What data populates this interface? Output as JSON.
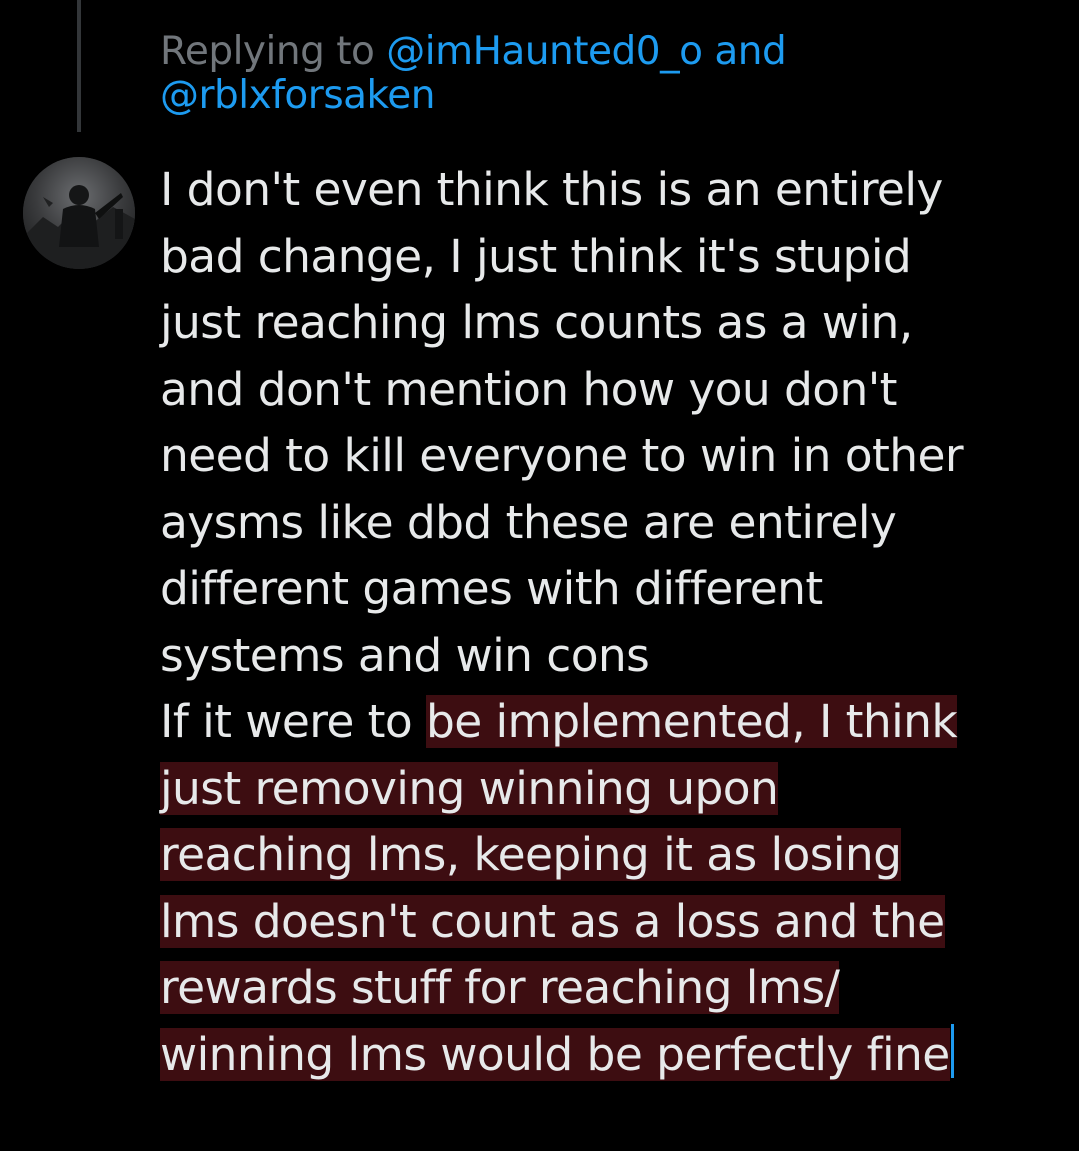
{
  "reply_header": {
    "prefix": "Replying to",
    "mention_1": "@imHaunted0_o",
    "joiner": "and",
    "mention_2": "@rblxforsaken"
  },
  "tweet": {
    "avatar_icon": "user-avatar-icon",
    "text_plain": "I don't even think this is an entirely\nbad change, I just think it's stupid\njust reaching lms counts as a win,\nand don't mention how you don't\nneed to kill everyone to win in other\naysms like dbd these are entirely\ndifferent games with different\nsystems and win cons\nIf it were to ",
    "text_selected": "be implemented, I think\njust removing winning upon\nreaching lms, keeping it as losing\nlms doesn't count as a loss and the\nrewards stuff for reaching lms/\nwinning lms would be perfectly fine"
  },
  "colors": {
    "background": "#000000",
    "text": "#e7e9ea",
    "secondary_text": "#71767b",
    "accent": "#1d9bf0",
    "selection": "#3d0d11"
  }
}
